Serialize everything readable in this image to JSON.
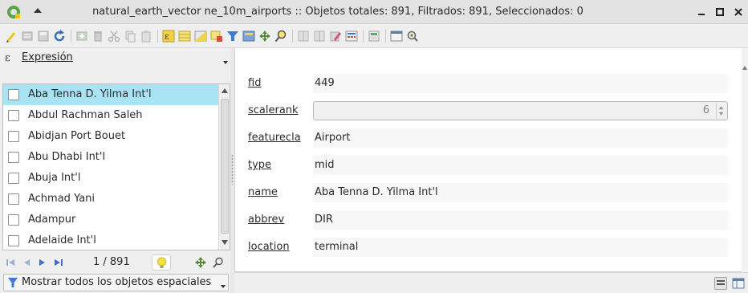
{
  "window": {
    "title": "natural_earth_vector ne_10m_airports :: Objetos totales: 891, Filtrados: 891, Seleccionados: 0"
  },
  "expression_selector": {
    "label": "Expresión"
  },
  "feature_list": {
    "items": [
      {
        "label": "Aba Tenna D. Yilma Int'l",
        "selected": true
      },
      {
        "label": "Abdul Rachman Saleh",
        "selected": false
      },
      {
        "label": "Abidjan Port Bouet",
        "selected": false
      },
      {
        "label": "Abu Dhabi Int'l",
        "selected": false
      },
      {
        "label": "Abuja Int'l",
        "selected": false
      },
      {
        "label": "Achmad Yani",
        "selected": false
      },
      {
        "label": "Adampur",
        "selected": false
      },
      {
        "label": "Adelaide Int'l",
        "selected": false
      }
    ]
  },
  "navigation": {
    "counter": "1 / 891"
  },
  "filter_button": {
    "label": "Mostrar todos los objetos espaciales"
  },
  "form": {
    "fields": [
      {
        "label": "fid",
        "value": "449"
      },
      {
        "label": "scalerank",
        "value": "6"
      },
      {
        "label": "featurecla",
        "value": "Airport"
      },
      {
        "label": "type",
        "value": "mid"
      },
      {
        "label": "name",
        "value": "Aba Tenna D. Yilma Int'l"
      },
      {
        "label": "abbrev",
        "value": "DIR"
      },
      {
        "label": "location",
        "value": "terminal"
      }
    ]
  },
  "colors": {
    "selection": "#a8e4f4",
    "qgis_green": "#59a344"
  }
}
